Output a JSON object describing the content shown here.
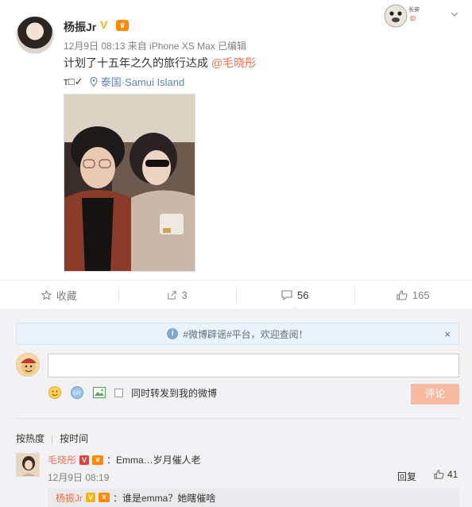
{
  "post": {
    "author": "杨振Jr",
    "verified_badge": "V",
    "meta": "12月9日 08:13 来自 iPhone XS Max  已编辑",
    "text": "计划了十五年之久的旅行达成 ",
    "mention": "@毛晓彤",
    "prefix": "т□✓",
    "location": "泰国·Samui Island"
  },
  "actions": {
    "favorite_label": "收藏",
    "share_count": "3",
    "comment_count": "56",
    "like_count": "165"
  },
  "comments": {
    "notice": "#微博辟谣#平台，欢迎查阅！",
    "notice_close": "×",
    "input_placeholder": "",
    "sync_label": "同时转发到我的微博",
    "submit_label": "评论",
    "sort_hot": "按热度",
    "sort_time": "按时间",
    "first": {
      "user": "毛晓彤",
      "text": "：Emma…岁月催人老",
      "time": "12月9日 08:19",
      "reply_label": "回复",
      "likes": "41"
    },
    "sub": {
      "user": "杨振Jr",
      "text": "：谁是emma？她瞎催啥"
    }
  },
  "colors": {
    "accent": "#eb7350",
    "link_blue": "#5e87b5",
    "submit_disabled": "#f7b9a0",
    "panel_bg": "#f2f2f5"
  }
}
